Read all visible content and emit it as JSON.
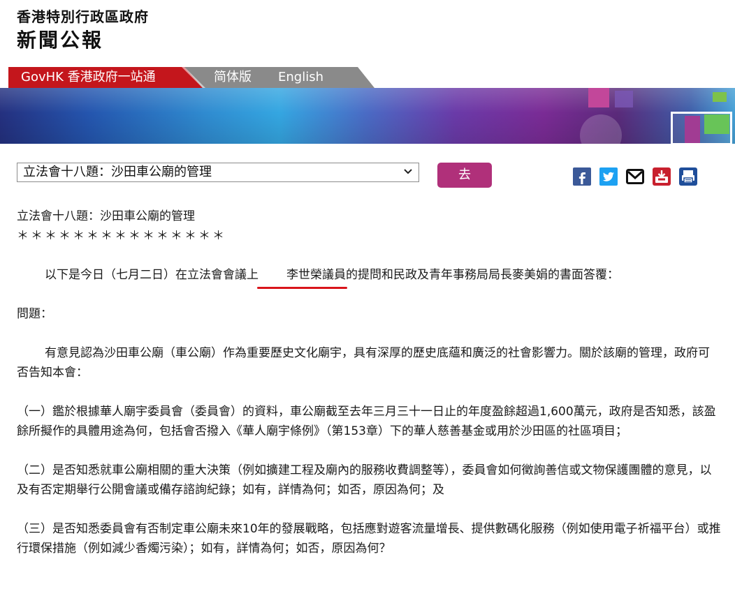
{
  "masthead": {
    "gov_name": "香港特別行政區政府",
    "press_name": "新聞公報"
  },
  "nav": {
    "govhk": "GovHK 香港政府一站通",
    "simplified": "简体版",
    "english": "English"
  },
  "selector": {
    "selected": "立法會十八題：沙田車公廟的管理",
    "go_label": "去"
  },
  "share_icons": [
    "facebook-icon",
    "twitter-icon",
    "mail-icon",
    "download-icon",
    "print-icon"
  ],
  "article": {
    "title": "立法會十八題：沙田車公廟的管理",
    "stars": "＊＊＊＊＊＊＊＊＊＊＊＊＊＊＊",
    "intro_before": "以下是今日（七月二日）在立法會會議上",
    "intro_name": "李世榮議員",
    "intro_after": "的提問和民政及青年事務局局長麥美娟的書面答覆：",
    "question_label": "問題：",
    "question_body": "有意見認為沙田車公廟（車公廟）作為重要歷史文化廟宇，具有深厚的歷史底蘊和廣泛的社會影響力。關於該廟的管理，政府可否告知本會：",
    "q1": "（一）鑑於根據華人廟宇委員會（委員會）的資料，車公廟截至去年三月三十一日止的年度盈餘超過1,600萬元，政府是否知悉，該盈餘所擬作的具體用途為何，包括會否撥入《華人廟宇條例》（第153章）下的華人慈善基金或用於沙田區的社區項目；",
    "q2": "（二）是否知悉就車公廟相關的重大決策（例如擴建工程及廟內的服務收費調整等），委員會如何徵詢善信或文物保護團體的意見，以及有否定期舉行公開會議或備存諮詢紀錄；如有，詳情為何；如否，原因為何；及",
    "q3": "（三）是否知悉委員會有否制定車公廟未來10年的發展戰略，包括應對遊客流量增長、提供數碼化服務（例如使用電子祈福平台）或推行環保措施（例如減少香燭污染）；如有，詳情為何；如否，原因為何？"
  },
  "colors": {
    "nav_red": "#c4161c",
    "nav_gray": "#8a8a8a",
    "go_button": "#b0307a",
    "underline": "#d9141b"
  }
}
